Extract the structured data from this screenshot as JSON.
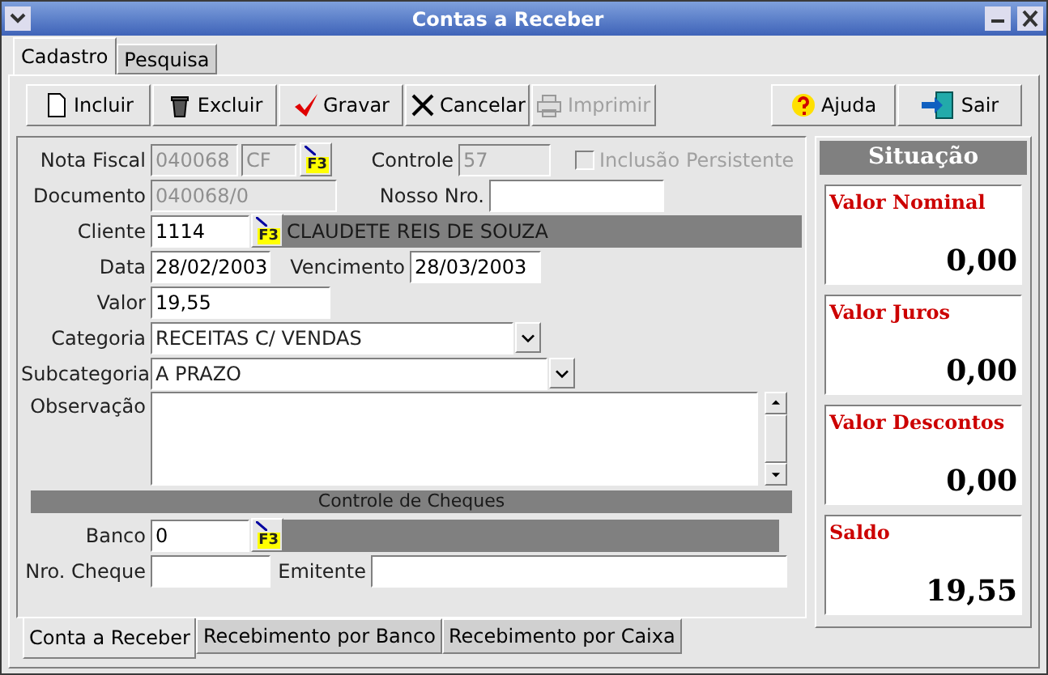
{
  "window": {
    "title": "Contas a Receber"
  },
  "tabs": [
    {
      "label": "Cadastro",
      "selected": true
    },
    {
      "label": "Pesquisa",
      "selected": false
    }
  ],
  "toolbar": {
    "left": [
      {
        "kind": "new",
        "label": "Incluir",
        "disabled": false
      },
      {
        "kind": "delete",
        "label": "Excluir",
        "disabled": false
      },
      {
        "kind": "save",
        "label": "Gravar",
        "disabled": false
      },
      {
        "kind": "cancel",
        "label": "Cancelar",
        "disabled": false
      },
      {
        "kind": "print",
        "label": "Imprimir",
        "disabled": true
      }
    ],
    "right": [
      {
        "kind": "help",
        "label": "Ajuda",
        "disabled": false
      },
      {
        "kind": "exit",
        "label": "Sair",
        "disabled": false
      }
    ]
  },
  "form": {
    "nota_fiscal": {
      "label": "Nota Fiscal",
      "value": "040068",
      "serie": "CF",
      "lookup": "F3"
    },
    "controle": {
      "label": "Controle",
      "value": "57"
    },
    "inclusao_persistente": {
      "label": "Inclusão Persistente",
      "checked": false,
      "disabled": true
    },
    "documento": {
      "label": "Documento",
      "value": "040068/0"
    },
    "nosso_nro": {
      "label": "Nosso Nro."
    },
    "cliente": {
      "label": "Cliente",
      "value": "1114",
      "lookup": "F3",
      "name": "CLAUDETE REIS DE SOUZA"
    },
    "data": {
      "label": "Data",
      "value": "28/02/2003"
    },
    "vencimento": {
      "label": "Vencimento",
      "value": "28/03/2003"
    },
    "valor": {
      "label": "Valor",
      "value": "19,55"
    },
    "categoria": {
      "label": "Categoria",
      "value": "RECEITAS C/ VENDAS"
    },
    "subcategoria": {
      "label": "Subcategoria",
      "value": "A PRAZO"
    },
    "observacao": {
      "label": "Observação"
    },
    "cheques": {
      "title": "Controle de Cheques",
      "banco": {
        "label": "Banco",
        "value": "0",
        "lookup": "F3"
      },
      "nro_cheque": {
        "label": "Nro. Cheque"
      },
      "emitente": {
        "label": "Emitente"
      }
    }
  },
  "situacao": {
    "title": "Situação",
    "cards": [
      {
        "label": "Valor Nominal",
        "value": "0,00"
      },
      {
        "label": "Valor Juros",
        "value": "0,00"
      },
      {
        "label": "Valor Descontos",
        "value": "0,00"
      },
      {
        "label": "Saldo",
        "value": "19,55"
      }
    ]
  },
  "bottom_tabs": [
    {
      "label": "Conta a Receber",
      "selected": true
    },
    {
      "label": "Recebimento por Banco",
      "selected": false
    },
    {
      "label": "Recebimento por Caixa",
      "selected": false
    }
  ]
}
